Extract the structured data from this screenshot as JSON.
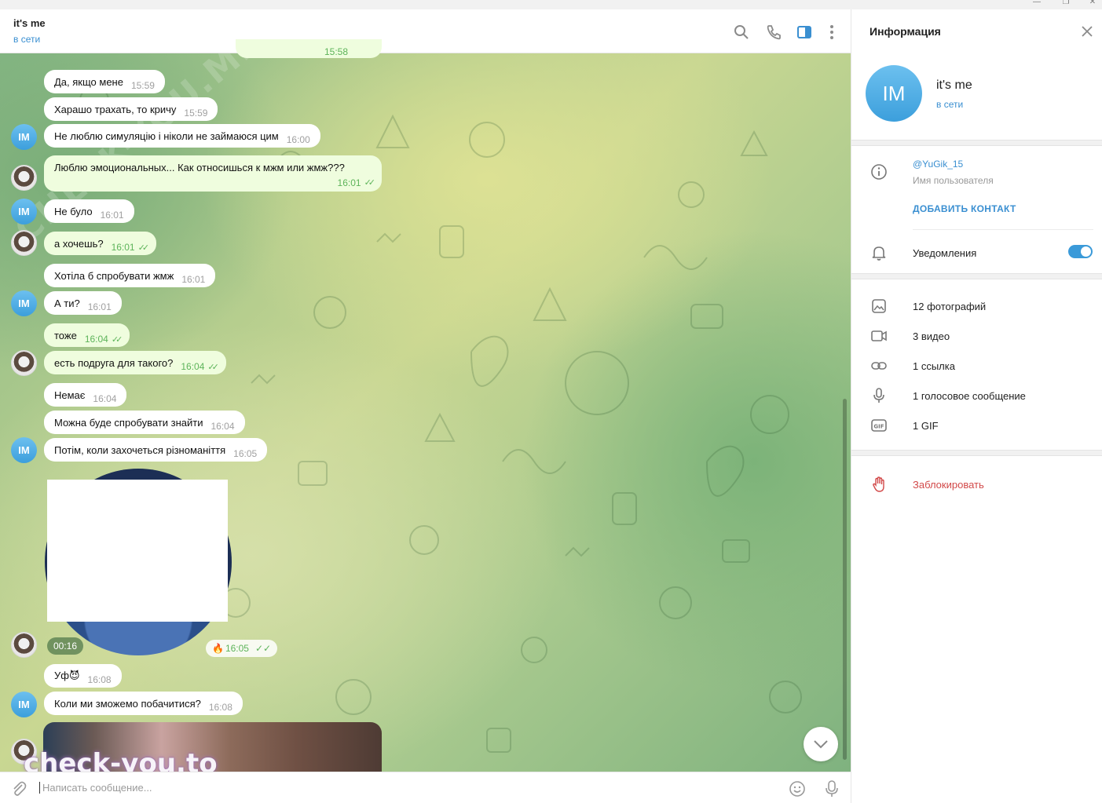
{
  "window": {
    "minimize": "—",
    "maximize": "❐",
    "close": "✕"
  },
  "chat": {
    "title": "it's me",
    "status": "в сети",
    "prev_time": "15:58",
    "avatar_initials": "IM",
    "messages": [
      {
        "text": "Да, якщо мене",
        "time": "15:59"
      },
      {
        "text": "Харашо трахать, то кричу",
        "time": "15:59"
      },
      {
        "text": "Не люблю симуляцію і ніколи не займаюся цим",
        "time": "16:00"
      },
      {
        "text": "Люблю эмоциональных... Как относишься к мжм или жмж???",
        "time": "16:01",
        "out": true
      },
      {
        "text": "Не було",
        "time": "16:01"
      },
      {
        "text": "а хочешь?",
        "time": "16:01",
        "out": true
      },
      {
        "text": "Хотіла б спробувати жмж",
        "time": "16:01"
      },
      {
        "text": "А ти?",
        "time": "16:01"
      },
      {
        "text": "тоже",
        "time": "16:04",
        "out": true
      },
      {
        "text": "есть подруга для такого?",
        "time": "16:04",
        "out": true
      },
      {
        "text": "Немає",
        "time": "16:04"
      },
      {
        "text": "Можна буде спробувати знайти",
        "time": "16:04"
      },
      {
        "text": "Потім, коли захочеться різноманіття",
        "time": "16:05"
      },
      {
        "text": "Уф😈",
        "time": "16:08"
      },
      {
        "text": "Коли ми зможемо побачитися?",
        "time": "16:08"
      }
    ],
    "video": {
      "duration": "00:16",
      "time": "16:05",
      "reaction": "🔥"
    },
    "compose_placeholder": "Написать сообщение..."
  },
  "watermark": {
    "bottom": "check-you.to",
    "diagonal": "CHECK-YOU.ME"
  },
  "panel": {
    "title": "Информация",
    "name": "it's me",
    "status": "в сети",
    "avatar_initials": "IM",
    "username": "@YuGik_15",
    "username_label": "Имя пользователя",
    "add_contact": "ДОБАВИТЬ КОНТАКТ",
    "notifications": "Уведомления",
    "notifications_on": true,
    "media": [
      {
        "icon": "photo-icon",
        "label": "12 фотографий"
      },
      {
        "icon": "video-icon",
        "label": "3 видео"
      },
      {
        "icon": "link-icon",
        "label": "1 ссылка"
      },
      {
        "icon": "microphone-icon",
        "label": "1 голосовое сообщение"
      },
      {
        "icon": "gif-icon",
        "label": "1 GIF"
      }
    ],
    "block": "Заблокировать"
  },
  "colors": {
    "accent": "#3a8fd1",
    "outgoing": "#effdde",
    "check": "#5db45a",
    "danger": "#d24949"
  }
}
